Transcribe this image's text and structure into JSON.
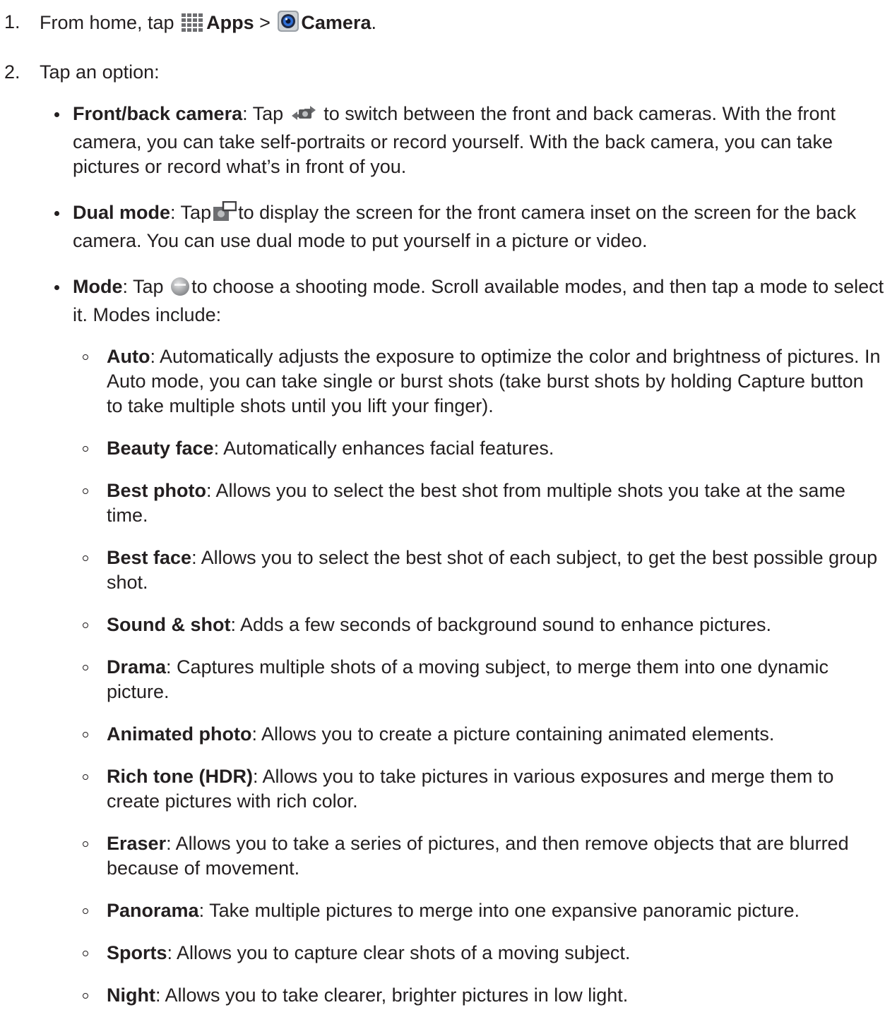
{
  "step1": {
    "number": "1.",
    "prefix": "From home, tap",
    "apps_label": "Apps",
    "separator": ">",
    "camera_label": "Camera",
    "suffix": "."
  },
  "step2": {
    "number": "2.",
    "text": "Tap an option:"
  },
  "options": {
    "front_back": {
      "term": "Front/back camera",
      "before_icon": ": Tap",
      "after_icon": "to switch between the front and back cameras. With the front camera, you can take self-portraits or record yourself. With the back camera, you can take pictures or record what’s in front of you."
    },
    "dual": {
      "term": "Dual mode",
      "before_icon": ": Tap",
      "after_icon": "to display the screen for the front camera inset on the screen for the back camera. You can use dual mode to put yourself in a picture or video."
    },
    "mode": {
      "term": "Mode",
      "before_icon": ": Tap",
      "after_icon": "to choose a shooting mode. Scroll available modes, and then tap a mode to select it. Modes include:"
    }
  },
  "modes": [
    {
      "term": "Auto",
      "desc": ": Automatically adjusts the exposure to optimize the color and brightness of pictures. In Auto mode, you can take single or burst shots (take burst shots by holding Capture button to take multiple shots until you lift your finger)."
    },
    {
      "term": "Beauty face",
      "desc": ": Automatically enhances facial features."
    },
    {
      "term": "Best photo",
      "desc": ": Allows you to select the best shot from multiple shots you take at the same time."
    },
    {
      "term": "Best face",
      "desc": ": Allows you to select the best shot of each subject, to get the best possible group shot."
    },
    {
      "term": "Sound & shot",
      "desc": ": Adds a few seconds of background sound to enhance pictures."
    },
    {
      "term": "Drama",
      "desc": ": Captures multiple shots of a moving subject, to merge them into one dynamic picture."
    },
    {
      "term": "Animated photo",
      "desc": ": Allows you to create a picture containing animated elements."
    },
    {
      "term": "Rich tone (HDR)",
      "desc": ": Allows you to take pictures in various exposures and merge them to create pictures with rich color."
    },
    {
      "term": "Eraser",
      "desc": ": Allows you to take a series of pictures, and then remove objects that are blurred because of movement."
    },
    {
      "term": "Panorama",
      "desc": ": Take multiple pictures to merge into one expansive panoramic picture."
    },
    {
      "term": "Sports",
      "desc": ": Allows you to capture clear shots of a moving subject."
    },
    {
      "term": "Night",
      "desc": ": Allows you to take clearer, brighter pictures in low light."
    }
  ],
  "icons": {
    "apps": "apps-grid-icon",
    "camera": "camera-app-icon",
    "switch": "switch-camera-icon",
    "dual": "dual-camera-icon",
    "mode": "mode-button-icon"
  },
  "colors": {
    "text": "#231f20"
  }
}
